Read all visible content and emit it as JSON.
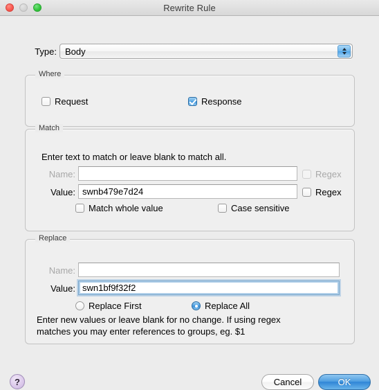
{
  "window": {
    "title": "Rewrite Rule",
    "traffic_lights": [
      "close-button",
      "minimize-button",
      "maximize-button"
    ]
  },
  "type_row": {
    "label": "Type:",
    "value": "Body",
    "stepper_icon": "stepper-up-down-icon"
  },
  "where": {
    "title": "Where",
    "request": {
      "label": "Request",
      "checked": false
    },
    "response": {
      "label": "Response",
      "checked": true
    }
  },
  "match": {
    "title": "Match",
    "hint": "Enter text to match or leave blank to match all.",
    "name_label": "Name:",
    "name_value": "",
    "name_placeholder": "",
    "name_regex_label": "Regex",
    "value_label": "Value:",
    "value_value": "swnb479e7d24",
    "value_placeholder": "",
    "value_regex_label": "Regex",
    "match_whole_value_label": "Match whole value",
    "case_sensitive_label": "Case sensitive"
  },
  "replace": {
    "title": "Replace",
    "name_label": "Name:",
    "name_value": "",
    "name_placeholder": "",
    "value_label": "Value:",
    "value_value": "swn1bf9f32f2",
    "value_placeholder": "",
    "replace_first_label": "Replace First",
    "replace_all_label": "Replace All",
    "helper_line1": "Enter new values or leave blank for no change. If using regex",
    "helper_line2": "matches you may enter references to groups, eg. $1"
  },
  "footer": {
    "help_label": "?",
    "cancel_label": "Cancel",
    "ok_label": "OK"
  },
  "colors": {
    "window_bg": "#ececec",
    "accent_blue": "#3e94dc",
    "default_button": "#2f85d6",
    "help_button": "#c9b4de",
    "disabled_text": "#a8a8a8"
  }
}
